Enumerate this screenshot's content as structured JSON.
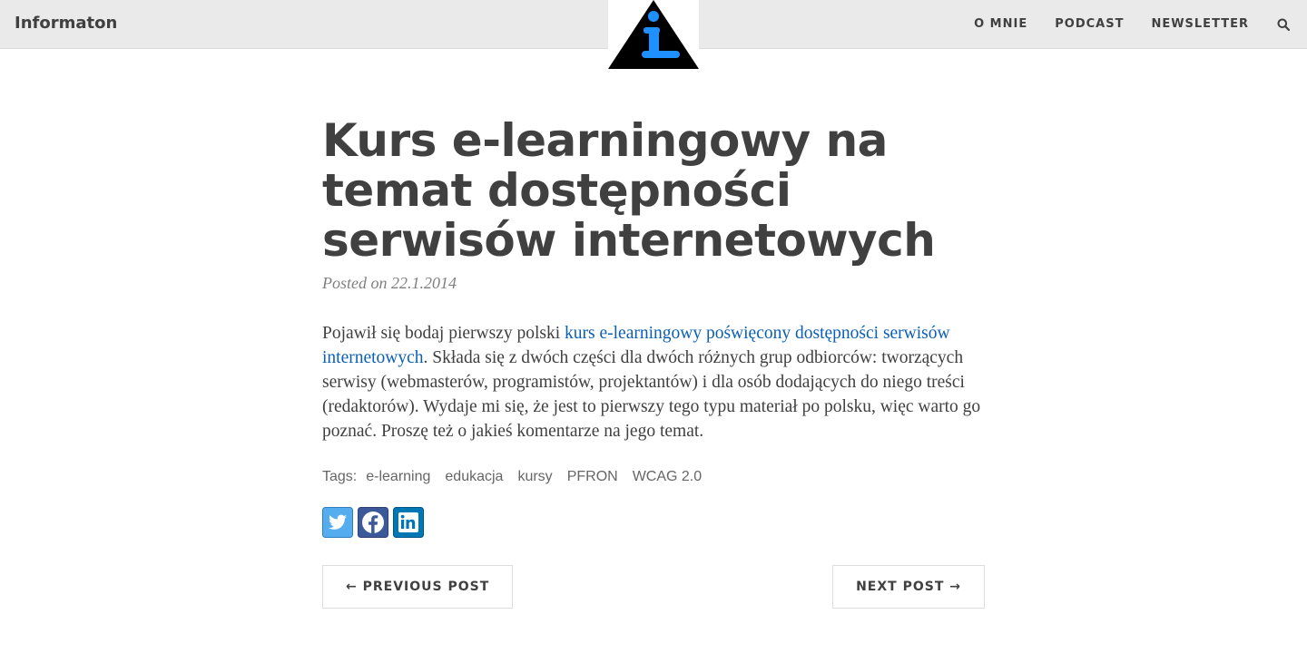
{
  "site": {
    "brand": "Informaton"
  },
  "nav": {
    "items": [
      "O MNIE",
      "PODCAST",
      "NEWSLETTER"
    ]
  },
  "post": {
    "title": "Kurs e-learningowy na temat dostępności serwisów internetowych",
    "posted": "Posted on 22.1.2014",
    "body_before_link": "Pojawił się bodaj pierwszy polski ",
    "link_text": "kurs e-learningowy poświęcony dostępności serwisów internetowych",
    "body_after_link": ". Składa się z dwóch części dla dwóch różnych grup odbiorców: tworzących serwisy (webmasterów, programistów, projektantów) i dla osób dodających do niego treści (redaktorów). Wydaje mi się, że jest to pierwszy tego typu materiał po polsku, więc warto go poznać. Proszę też o jakieś komentarze na jego temat."
  },
  "tags": {
    "label": "Tags:",
    "items": [
      "e-learning",
      "edukacja",
      "kursy",
      "PFRON",
      "WCAG 2.0"
    ]
  },
  "share": {
    "icons": [
      "twitter-icon",
      "facebook-icon",
      "linkedin-icon"
    ],
    "colors": {
      "twitter": "#55acee",
      "facebook": "#3b5998",
      "linkedin": "#0077b5"
    }
  },
  "pager": {
    "previous": "← PREVIOUS POST",
    "next": "NEXT POST →"
  },
  "colors": {
    "topbar": "#eaeaea",
    "text": "#404040",
    "link": "#0b5fb5",
    "logo_blue": "#1e90ff"
  }
}
